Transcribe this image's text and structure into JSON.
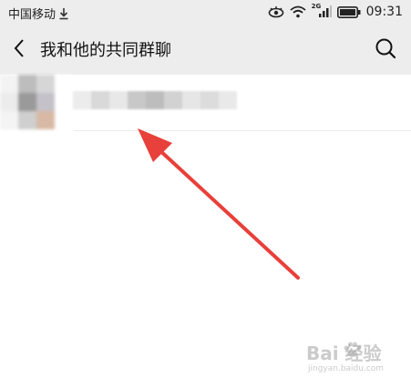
{
  "status_bar": {
    "carrier": "中国移动",
    "network": "2G",
    "time": "09:31"
  },
  "nav": {
    "title": "我和他的共同群聊"
  },
  "watermark": {
    "brand": "Bai 经验",
    "domain": "jingyan.baidu.com"
  },
  "colors": {
    "nav_background": "#ededed",
    "arrow": "#e8403a"
  }
}
